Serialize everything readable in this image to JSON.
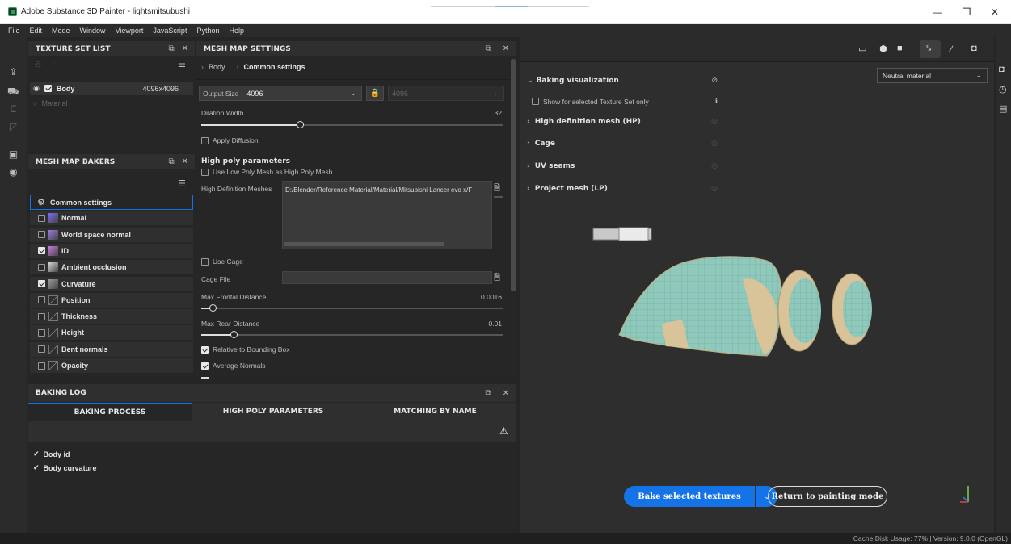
{
  "window": {
    "title": "Adobe Substance 3D Painter - lightsmitsubushi",
    "minimize": "—",
    "maximize": "❐",
    "close": "✕"
  },
  "menu": [
    "File",
    "Edit",
    "Mode",
    "Window",
    "Viewport",
    "JavaScript",
    "Python",
    "Help"
  ],
  "texture_set_list": {
    "title": "TEXTURE SET LIST",
    "body_name": "Body",
    "body_size": "4096x4096",
    "material": "Material"
  },
  "mesh_map_bakers": {
    "title": "MESH MAP BAKERS",
    "items": [
      {
        "label": "Common settings",
        "checked": null
      },
      {
        "label": "Normal",
        "checked": false
      },
      {
        "label": "World space normal",
        "checked": false
      },
      {
        "label": "ID",
        "checked": true
      },
      {
        "label": "Ambient occlusion",
        "checked": false
      },
      {
        "label": "Curvature",
        "checked": true
      },
      {
        "label": "Position",
        "checked": false
      },
      {
        "label": "Thickness",
        "checked": false
      },
      {
        "label": "Height",
        "checked": false
      },
      {
        "label": "Bent normals",
        "checked": false
      },
      {
        "label": "Opacity",
        "checked": false
      }
    ]
  },
  "mesh_map_settings": {
    "title": "MESH MAP SETTINGS",
    "breadcrumb_body": "Body",
    "breadcrumb_common": "Common settings",
    "output_size_label": "Output Size",
    "output_size_value": "4096",
    "output_size_locked_value": "4096",
    "dilation_label": "Dilation Width",
    "dilation_value": "32",
    "dilation_level": 0.33,
    "apply_diffusion": "Apply Diffusion",
    "hp_header": "High poly parameters",
    "use_low_poly": "Use Low Poly Mesh as High Poly Mesh",
    "hd_meshes_label": "High Definition Meshes",
    "hd_meshes_path": "D:/Blender/Reference Material/Material/Mitsubishi Lancer evo x/F",
    "use_cage": "Use Cage",
    "cage_file_label": "Cage File",
    "max_frontal_label": "Max Frontal Distance",
    "max_frontal_value": "0.0016",
    "max_frontal_level": 0.04,
    "max_rear_label": "Max Rear Distance",
    "max_rear_value": "0.01",
    "max_rear_level": 0.11,
    "relative_bbox": "Relative to Bounding Box",
    "average_normals": "Average Normals"
  },
  "baking_log": {
    "title": "BAKING LOG",
    "tabs": [
      "BAKING PROCESS",
      "HIGH POLY PARAMETERS",
      "MATCHING BY NAME"
    ],
    "entries": [
      "Body id",
      "Body curvature"
    ]
  },
  "viewport": {
    "baking_visualization": "Baking visualization",
    "show_selected_only": "Show for selected Texture Set only",
    "sections": [
      "High definition mesh (HP)",
      "Cage",
      "UV seams",
      "Project mesh (LP)"
    ],
    "material_dropdown": "Neutral material",
    "bake_button": "Bake selected textures",
    "return_button": "Return to painting mode"
  },
  "status": {
    "text": "Cache Disk Usage:  77% | Version: 9.0.0 (OpenGL)"
  },
  "colors": {
    "accent": "#1473e6",
    "panel_bg": "#262626",
    "mesh_teal": "#8fc9bc",
    "mesh_tan": "#d9c49a"
  }
}
